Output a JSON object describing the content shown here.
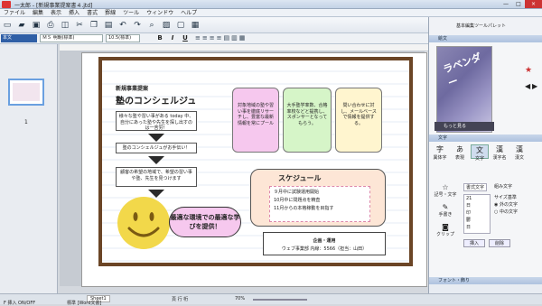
{
  "window": {
    "title": "一太郎 - [新規事業提案書４.jtd]",
    "minimize": "—",
    "maximize": "□",
    "close": "×"
  },
  "menu": [
    "ファイル",
    "編集",
    "表示",
    "挿入",
    "書式",
    "罫線",
    "ツール",
    "ウィンドウ",
    "ヘルプ"
  ],
  "toolbar": {
    "mode_label": "文字",
    "mode_icon": "A",
    "layout_icon": "≡"
  },
  "toolbar2": {
    "style": "本文",
    "font": "ＭＳ 明朝(標準)",
    "size": "10.5(標準)",
    "bold": "B",
    "italic": "I",
    "underline": "U"
  },
  "sheet_tab": "Sheet1",
  "status": {
    "left": "F 挿入 ON/OFF",
    "doc": "標準 [Word文書]",
    "zoom": "70%",
    "page_info": "頁 行 桁",
    "mode": "ON"
  },
  "page": {
    "header_label": "新規事業提案",
    "title": "塾のコンシェルジュ",
    "step1": "様々な塾や習い事がある today 中、自分にあった塾や先生を探し出すのは一苦労！",
    "step2": "塾のコンシェルジュがお手伝い！",
    "step3": "顧客の希望の地域で、希望の習い事や塾、先生を見つけます",
    "smile_text": "最適な環境での最適な学びを提供！",
    "card1": "対象地域の塾や習い事を徹底リサーチし、豊富な最新情報を常にプール",
    "card2": "大手塾学率数、合格率校などと提携し、スポンサーとなってもらう。",
    "card3": "問い合わせに対し、メールベースで情報を提供する。",
    "schedule_title": "スケジュール",
    "schedule": [
      "９月中に試験運用開始",
      "10月中に問題点を精査",
      "11月からの本格稼動を目指す"
    ],
    "dept_label": "企画・運用",
    "dept_detail": "ウェブ事業部 内線：5566（担当：山田）"
  },
  "right_panel": {
    "palette_title": "基本編集ツールパレット",
    "image_section": "絵文",
    "image_text": "ラベンダー",
    "more_button": "もっと見る",
    "text_section": "文字",
    "tools": [
      "異体字",
      "表現",
      "文字",
      "漢字名",
      "漢文"
    ],
    "tools2": [
      "記号・文字",
      "手書き",
      "クリップ"
    ],
    "tabs": [
      "書式文字",
      "組み文字"
    ],
    "size_label": "サイズ基準",
    "opt1": "外の文字",
    "opt2": "中の文字",
    "list": [
      "21",
      "日",
      "印",
      "鬱",
      "日"
    ],
    "insert": "挿入",
    "delete": "削除",
    "font_section": "フォント・飾り"
  },
  "page_number": "1",
  "colors": {
    "pink": "#f6c8ee",
    "green": "#d6f5c8",
    "cream": "#fff5cf",
    "schedule": "#fde6d6",
    "smile": "#f2d84a",
    "navy": "#2f5fa6"
  }
}
